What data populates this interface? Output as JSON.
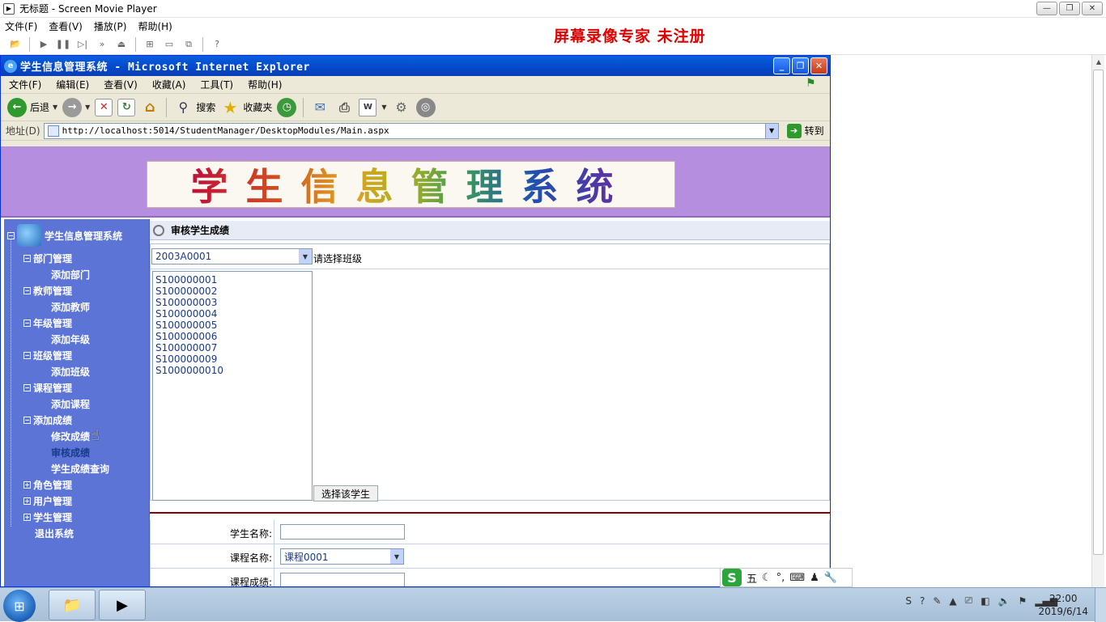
{
  "player": {
    "title": "无标题 - Screen Movie Player",
    "menu": [
      "文件(F)",
      "查看(V)",
      "播放(P)",
      "帮助(H)"
    ],
    "watermark": "屏幕录像专家  未注册"
  },
  "ie": {
    "title": "学生信息管理系统 - Microsoft Internet Explorer",
    "menu": [
      "文件(F)",
      "编辑(E)",
      "查看(V)",
      "收藏(A)",
      "工具(T)",
      "帮助(H)"
    ],
    "toolbar": {
      "back": "后退",
      "search": "搜索",
      "favorites": "收藏夹"
    },
    "address_label": "地址(D)",
    "address": "http://localhost:5014/StudentManager/DesktopModules/Main.aspx",
    "go": "转到"
  },
  "banner": {
    "text": "学生信息管理系统"
  },
  "sidebar": {
    "root": "学生信息管理系统",
    "groups": [
      {
        "label": "部门管理",
        "children": [
          "添加部门"
        ]
      },
      {
        "label": "教师管理",
        "children": [
          "添加教师"
        ]
      },
      {
        "label": "年级管理",
        "children": [
          "添加年级"
        ]
      },
      {
        "label": "班级管理",
        "children": [
          "添加班级"
        ]
      },
      {
        "label": "课程管理",
        "children": [
          "添加课程"
        ]
      },
      {
        "label": "添加成绩",
        "children": [
          "修改成绩",
          "审核成绩",
          "学生成绩查询"
        ]
      },
      {
        "label": "角色管理",
        "children": []
      },
      {
        "label": "用户管理",
        "children": []
      },
      {
        "label": "学生管理",
        "children": []
      }
    ],
    "logout": "退出系统"
  },
  "main": {
    "title": "审核学生成绩",
    "class_select": "2003A0001",
    "class_hint": "请选择班级",
    "students": [
      "S100000001",
      "S100000002",
      "S100000003",
      "S100000004",
      "S100000005",
      "S100000006",
      "S100000007",
      "S100000009",
      "S1000000010"
    ],
    "select_button": "选择该学生",
    "form": {
      "student_name_label": "学生名称:",
      "course_name_label": "课程名称:",
      "course_value": "课程0001",
      "score_label": "课程成绩:"
    }
  },
  "ime": {
    "label": "五"
  },
  "taskbar": {
    "time": "22:00",
    "date": "2019/6/14"
  }
}
